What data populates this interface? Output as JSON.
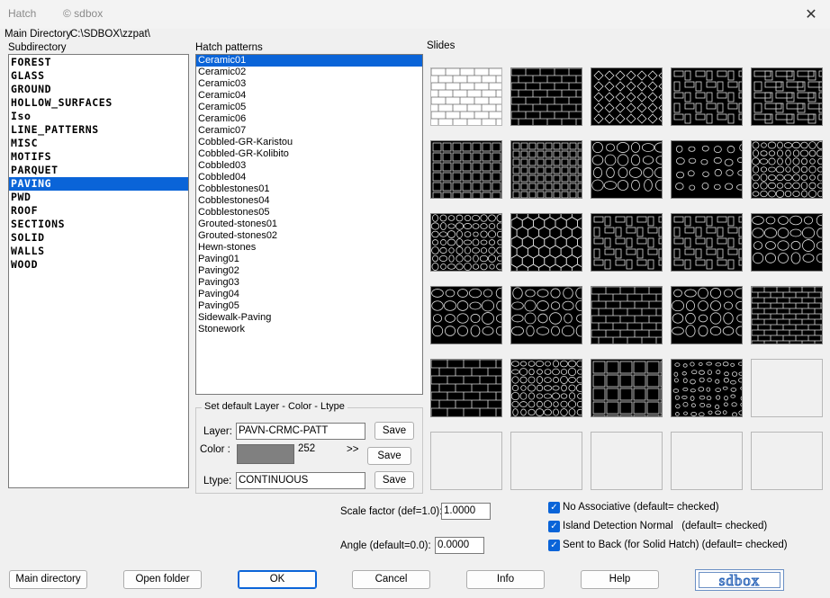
{
  "window": {
    "title": "Hatch",
    "subtitle": "© sdbox",
    "close_glyph": "✕"
  },
  "main_directory": {
    "label": "Main Directory",
    "path": "C:\\SDBOX\\zzpat\\"
  },
  "subdirectory": {
    "label": "Subdirectory",
    "items": [
      "FOREST",
      "GLASS",
      "GROUND",
      "HOLLOW_SURFACES",
      "Iso",
      "LINE_PATTERNS",
      "MISC",
      "MOTIFS",
      "PARQUET",
      "PAVING",
      "PWD",
      "ROOF",
      "SECTIONS",
      "SOLID",
      "WALLS",
      "WOOD"
    ],
    "selected": "PAVING"
  },
  "hatch_patterns": {
    "label": "Hatch patterns",
    "items": [
      "Ceramic01",
      "Ceramic02",
      "Ceramic03",
      "Ceramic04",
      "Ceramic05",
      "Ceramic06",
      "Ceramic07",
      "Cobbled-GR-Karistou",
      "Cobbled-GR-Kolibito",
      "Cobbled03",
      "Cobbled04",
      "Cobblestones01",
      "Cobblestones04",
      "Cobblestones05",
      "Grouted-stones01",
      "Grouted-stones02",
      "Hewn-stones",
      "Paving01",
      "Paving02",
      "Paving03",
      "Paving04",
      "Paving05",
      "Sidewalk-Paving",
      "Stonework"
    ],
    "selected": "Ceramic01"
  },
  "slides": {
    "label": "Slides",
    "thumbs": [
      "ceramic-light",
      "ceramic-bricks",
      "ceramic-diagonal",
      "ceramic-herringbone",
      "ceramic-basket",
      "square-grid",
      "square-grid-small",
      "cobble-large",
      "cobble-dots",
      "cobble-small",
      "cobble-fine",
      "hexagon",
      "cross-tile",
      "bone-tile",
      "stone-round",
      "stone-large",
      "stone-grouted",
      "stonework-rect",
      "stonework-irregular",
      "brick-small",
      "brick-wall",
      "stone-crazy",
      "paving-square",
      "pebbles",
      "empty",
      "empty",
      "empty",
      "empty",
      "empty",
      "empty"
    ]
  },
  "defaults": {
    "legend": "Set default Layer - Color - Ltype",
    "layer_label": "Layer:",
    "layer_value": "PAVN-CRMC-PATT",
    "color_label": "Color  :",
    "color_value": "252",
    "color_hex": "#808080",
    "arrows": ">>",
    "ltype_label": "Ltype:",
    "ltype_value": "CONTINUOUS",
    "save_label": "Save"
  },
  "scale": {
    "label": "Scale factor (def=1.0):",
    "value": "1.0000"
  },
  "angle": {
    "label": "Angle (default=0.0):",
    "value": "0.0000"
  },
  "options": {
    "no_associative": "No Associative (default= checked)",
    "island_detection": "Island Detection Normal   (default= checked)",
    "send_to_back": "Sent to Back (for Solid Hatch) (default= checked)",
    "check_glyph": "✓"
  },
  "buttons": {
    "main_directory": "Main directory",
    "open_folder": "Open folder",
    "ok": "OK",
    "cancel": "Cancel",
    "info": "Info",
    "help": "Help"
  },
  "logo_text": "sdbox",
  "colors": {
    "accent": "#0a64d8"
  }
}
